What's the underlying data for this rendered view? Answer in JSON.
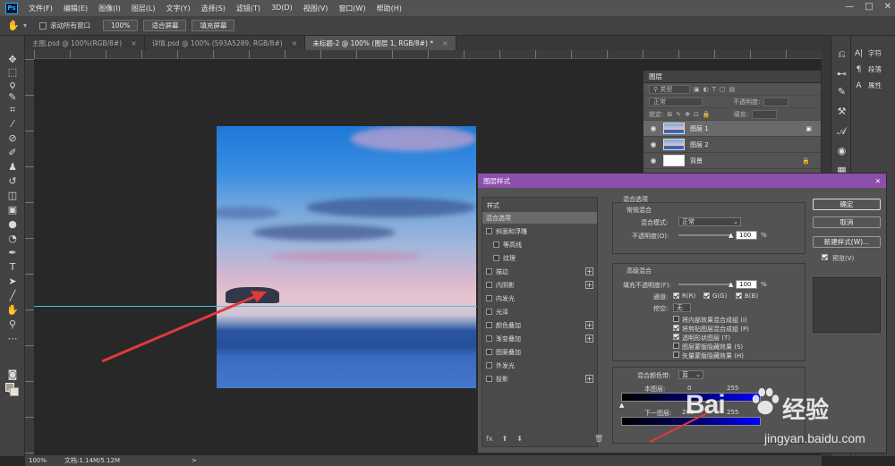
{
  "menu": {
    "logo": "Ps",
    "items": [
      "文件(F)",
      "编辑(E)",
      "图像(I)",
      "图层(L)",
      "文字(Y)",
      "选择(S)",
      "滤镜(T)",
      "3D(D)",
      "视图(V)",
      "窗口(W)",
      "帮助(H)"
    ],
    "window_controls": [
      "—",
      "□",
      "✕"
    ]
  },
  "options": {
    "scroll_all": "滚动所有窗口",
    "zoom": "100%",
    "fit_screen": "适合屏幕",
    "fill_screen": "填充屏幕"
  },
  "tabs": [
    {
      "label": "主图.psd @ 100%(RGB/8#)",
      "active": false
    },
    {
      "label": "详情.psd @ 100% (593A5289, RGB/8#)",
      "active": false
    },
    {
      "label": "未标题-2 @ 100% (图层 1, RGB/8#) *",
      "active": true
    }
  ],
  "layers_panel": {
    "title": "图层",
    "kind_label": "类型",
    "blend_mode": "正常",
    "opacity_label": "不透明度:",
    "lock_label": "锁定:",
    "fill_label": "填充:",
    "layers": [
      {
        "name": "图层 1",
        "selected": true
      },
      {
        "name": "图层 2",
        "selected": false
      },
      {
        "name": "背景",
        "selected": false
      }
    ]
  },
  "right_panel": {
    "items": [
      {
        "icon": "A|",
        "label": "字符"
      },
      {
        "icon": "¶",
        "label": "段落"
      },
      {
        "icon": "A",
        "label": "属性"
      }
    ]
  },
  "dialog": {
    "title": "图层样式",
    "close": "✕",
    "styles_header": "样式",
    "styles": [
      {
        "label": "混合选项",
        "check": false,
        "plus": false,
        "selected": true,
        "indent": false
      },
      {
        "label": "斜面和浮雕",
        "check": true,
        "plus": false,
        "selected": false,
        "indent": false
      },
      {
        "label": "等高线",
        "check": true,
        "plus": false,
        "selected": false,
        "indent": true
      },
      {
        "label": "纹理",
        "check": true,
        "plus": false,
        "selected": false,
        "indent": true
      },
      {
        "label": "描边",
        "check": true,
        "plus": true,
        "selected": false,
        "indent": false
      },
      {
        "label": "内阴影",
        "check": true,
        "plus": true,
        "selected": false,
        "indent": false
      },
      {
        "label": "内发光",
        "check": true,
        "plus": false,
        "selected": false,
        "indent": false
      },
      {
        "label": "光泽",
        "check": true,
        "plus": false,
        "selected": false,
        "indent": false
      },
      {
        "label": "颜色叠加",
        "check": true,
        "plus": true,
        "selected": false,
        "indent": false
      },
      {
        "label": "渐变叠加",
        "check": true,
        "plus": true,
        "selected": false,
        "indent": false
      },
      {
        "label": "图案叠加",
        "check": true,
        "plus": false,
        "selected": false,
        "indent": false
      },
      {
        "label": "外发光",
        "check": true,
        "plus": false,
        "selected": false,
        "indent": false
      },
      {
        "label": "投影",
        "check": true,
        "plus": true,
        "selected": false,
        "indent": false
      }
    ],
    "footer": {
      "fx": "fx",
      "up": "⬆",
      "down": "⬇",
      "trash": "🗑"
    },
    "blend": {
      "section": "混合选项",
      "general": "常规混合",
      "mode_label": "混合模式:",
      "mode_value": "正常",
      "opacity_label": "不透明度(O):",
      "opacity_value": "100",
      "pct": "%",
      "advanced": "高级混合",
      "fill_opacity_label": "填充不透明度(F):",
      "fill_opacity_value": "100",
      "channels_label": "通道:",
      "channels": [
        {
          "label": "R(R)",
          "on": true
        },
        {
          "label": "G(G)",
          "on": true
        },
        {
          "label": "B(B)",
          "on": true
        }
      ],
      "knockout_label": "挖空:",
      "knockout_value": "无",
      "options": [
        {
          "label": "将内部效果混合成组 (I)",
          "on": false
        },
        {
          "label": "将剪贴图层混合成组 (P)",
          "on": true
        },
        {
          "label": "透明形状图层 (T)",
          "on": true
        },
        {
          "label": "图层蒙版隐藏效果 (S)",
          "on": false
        },
        {
          "label": "矢量蒙版隐藏效果 (H)",
          "on": false
        }
      ],
      "blend_if_label": "混合颜色带:",
      "blend_if_value": "蓝",
      "this_layer_label": "本图层:",
      "this_layer_low": "0",
      "this_layer_high": "255",
      "under_layer_label": "下一图层:",
      "under_layer_low": "208",
      "under_layer_high": "255"
    },
    "buttons": {
      "ok": "确定",
      "cancel": "取消",
      "new_style": "新建样式(W)...",
      "preview_label": "预览(V)"
    }
  },
  "status": {
    "zoom": "100%",
    "doc": "文档:1.14M/5.12M",
    "arrow": ">"
  },
  "watermark": {
    "logo": "Bai",
    "text": "经验",
    "url": "jingyan.baidu.com"
  },
  "colors": {
    "dialog_title": "#8c4fae",
    "guide": "#3fc6d6",
    "arrow": "#e03a3a"
  }
}
